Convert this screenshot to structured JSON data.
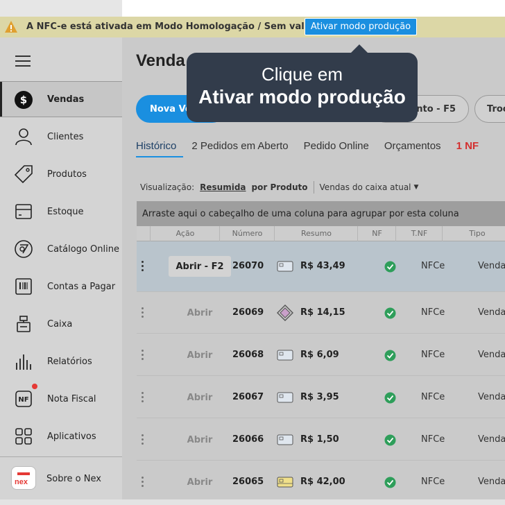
{
  "banner": {
    "text": "A NFC-e está ativada em Modo Homologação / Sem valor fiscal",
    "button_label": "Ativar modo produção"
  },
  "sidebar": {
    "items": [
      {
        "label": "Vendas",
        "icon": "dollar-icon"
      },
      {
        "label": "Clientes",
        "icon": "user-icon"
      },
      {
        "label": "Produtos",
        "icon": "tag-icon"
      },
      {
        "label": "Estoque",
        "icon": "box-icon"
      },
      {
        "label": "Catálogo Online",
        "icon": "catalog-icon"
      },
      {
        "label": "Contas a Pagar",
        "icon": "barcode-icon"
      },
      {
        "label": "Caixa",
        "icon": "register-icon"
      },
      {
        "label": "Relatórios",
        "icon": "bar-chart-icon"
      },
      {
        "label": "Nota Fiscal",
        "icon": "nf-icon"
      },
      {
        "label": "Aplicativos",
        "icon": "apps-icon"
      }
    ],
    "about_label": "Sobre o Nex",
    "logo_text": "nex",
    "nf_icon_text": "NF"
  },
  "main": {
    "title": "Venda",
    "nova_label": "Nova Ve",
    "orc_label": "ento - F5",
    "troc_label": "Troc",
    "tabs": [
      "Histórico",
      "2 Pedidos em Aberto",
      "Pedido Online",
      "Orçamentos",
      "1 NF"
    ],
    "viz_label": "Visualização:",
    "viz_opt1": "Resumida",
    "viz_opt2": "por Produto",
    "viz_dropdown": "Vendas do caixa atual",
    "group_hint": "Arraste aqui o cabeçalho de uma coluna para agrupar por esta coluna",
    "columns": [
      "Ação",
      "Número",
      "Resumo",
      "NF",
      "T.NF",
      "Tipo"
    ],
    "rows": [
      {
        "action": "Abrir - F2",
        "number": "26070",
        "value": "R$ 43,49",
        "payment": "card",
        "tnf": "NFCe",
        "tipo": "Venda"
      },
      {
        "action": "Abrir",
        "number": "26069",
        "value": "R$ 14,15",
        "payment": "pix",
        "tnf": "NFCe",
        "tipo": "Venda"
      },
      {
        "action": "Abrir",
        "number": "26068",
        "value": "R$ 6,09",
        "payment": "card",
        "tnf": "NFCe",
        "tipo": "Venda"
      },
      {
        "action": "Abrir",
        "number": "26067",
        "value": "R$ 3,95",
        "payment": "card",
        "tnf": "NFCe",
        "tipo": "Venda"
      },
      {
        "action": "Abrir",
        "number": "26066",
        "value": "R$ 1,50",
        "payment": "card",
        "tnf": "NFCe",
        "tipo": "Venda"
      },
      {
        "action": "Abrir",
        "number": "26065",
        "value": "R$ 42,00",
        "payment": "card-yellow",
        "tnf": "NFCe",
        "tipo": "Venda"
      }
    ]
  },
  "tooltip": {
    "line1": "Clique em",
    "line2": "Ativar modo produção"
  },
  "colors": {
    "accent": "#1a8fe0",
    "tooltip_bg": "#323c4b",
    "banner_bg": "#dcd7a6",
    "success": "#2e9e5a",
    "alert": "#d32f2f"
  }
}
